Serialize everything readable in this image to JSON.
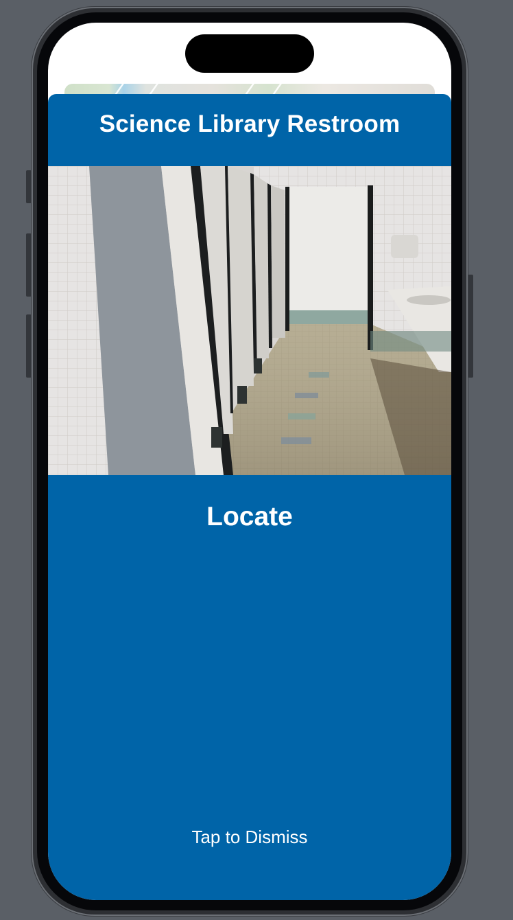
{
  "sheet": {
    "title": "Science Library Restroom",
    "image": {
      "subject": "restroom-photo",
      "alt": ""
    },
    "locate_label": "Locate",
    "dismiss_label": "Tap to Dismiss"
  },
  "colors": {
    "sheet_background": "#0064a8",
    "text": "#ffffff",
    "backdrop": "#5a5f66",
    "phone_frame": "#2d2f33"
  }
}
